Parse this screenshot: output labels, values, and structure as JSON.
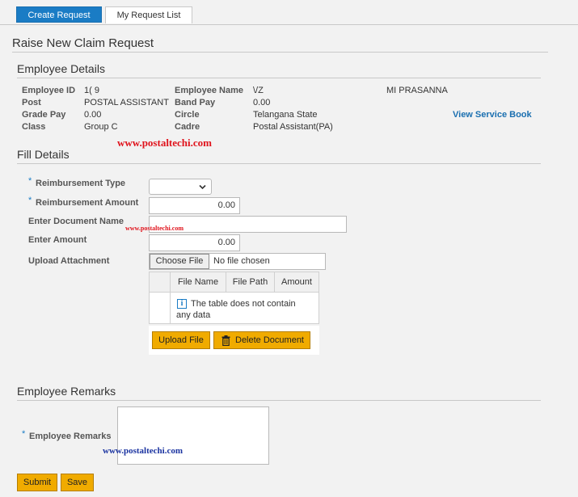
{
  "tabs": {
    "create": "Create Request",
    "list": "My Request List"
  },
  "page_title": "Raise New Claim Request",
  "employee_details": {
    "heading": "Employee Details",
    "id_label": "Employee ID",
    "id_value": "1(      9",
    "name_label": "Employee Name",
    "name_value": "\\/Z",
    "name_value2": "MI PRASANNA",
    "post_label": "Post",
    "post_value": "POSTAL ASSISTANT",
    "band_label": "Band Pay",
    "band_value": "0.00",
    "grade_label": "Grade Pay",
    "grade_value": "0.00",
    "circle_label": "Circle",
    "circle_value": "Telangana State",
    "service_book_link": "View Service Book",
    "class_label": "Class",
    "class_value": "Group C",
    "cadre_label": "Cadre",
    "cadre_value": "Postal Assistant(PA)"
  },
  "watermarks": {
    "main": "www.postaltechi.com",
    "small": "www.postaltechi.com",
    "bottom": "www.postaltechi.com"
  },
  "fill_details": {
    "heading": "Fill Details",
    "reimb_type_label": "Reimbursement Type",
    "reimb_amount_label": "Reimbursement Amount",
    "reimb_amount_value": "0.00",
    "doc_name_label": "Enter Document Name",
    "amount_label": "Enter Amount",
    "amount_value": "0.00",
    "upload_label": "Upload Attachment",
    "choose_file": "Choose File",
    "no_file": "No file chosen",
    "table": {
      "columns": [
        "File Name",
        "File Path",
        "Amount"
      ],
      "empty_text": "The table does not contain any data"
    },
    "upload_file_btn": "Upload File",
    "delete_doc_btn": "Delete Document"
  },
  "remarks": {
    "heading": "Employee Remarks",
    "label": "Employee Remarks"
  },
  "actions": {
    "submit": "Submit",
    "save": "Save"
  },
  "colors": {
    "accent": "#1a7cc5",
    "button": "#f0ab00",
    "watermark_red": "#e0131c",
    "watermark_blue": "#1a33a0"
  }
}
